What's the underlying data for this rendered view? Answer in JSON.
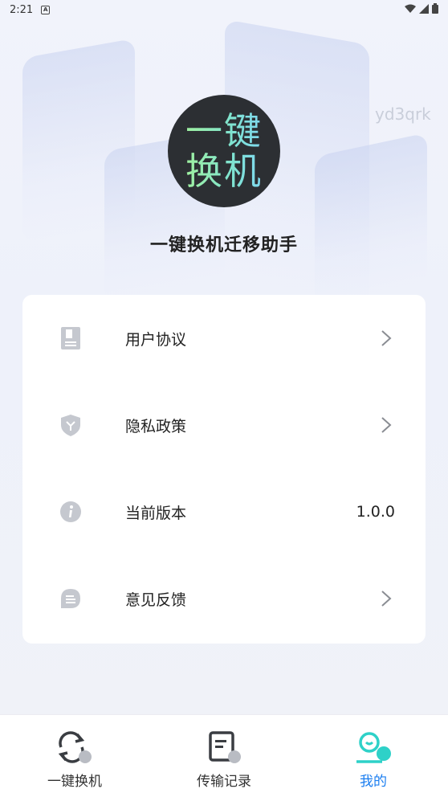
{
  "status_bar": {
    "time": "2:21",
    "notification_glyph": "A"
  },
  "watermark": "yd3qrk",
  "logo": {
    "line1": "一键",
    "line2": "换机"
  },
  "app_title": "一键换机迁移助手",
  "menu": [
    {
      "label": "用户协议",
      "icon": "document-icon",
      "has_chevron": true
    },
    {
      "label": "隐私政策",
      "icon": "shield-icon",
      "has_chevron": true
    },
    {
      "label": "当前版本",
      "icon": "info-icon",
      "value": "1.0.0"
    },
    {
      "label": "意见反馈",
      "icon": "chat-icon",
      "has_chevron": true
    }
  ],
  "bottom_nav": [
    {
      "label": "一键换机",
      "icon": "sync-icon",
      "active": false
    },
    {
      "label": "传输记录",
      "icon": "record-icon",
      "active": false
    },
    {
      "label": "我的",
      "icon": "profile-icon",
      "active": true
    }
  ],
  "colors": {
    "accent": "#1b7ef0",
    "teal": "#2ed1c8",
    "icon_gray": "#c5c8cf"
  }
}
